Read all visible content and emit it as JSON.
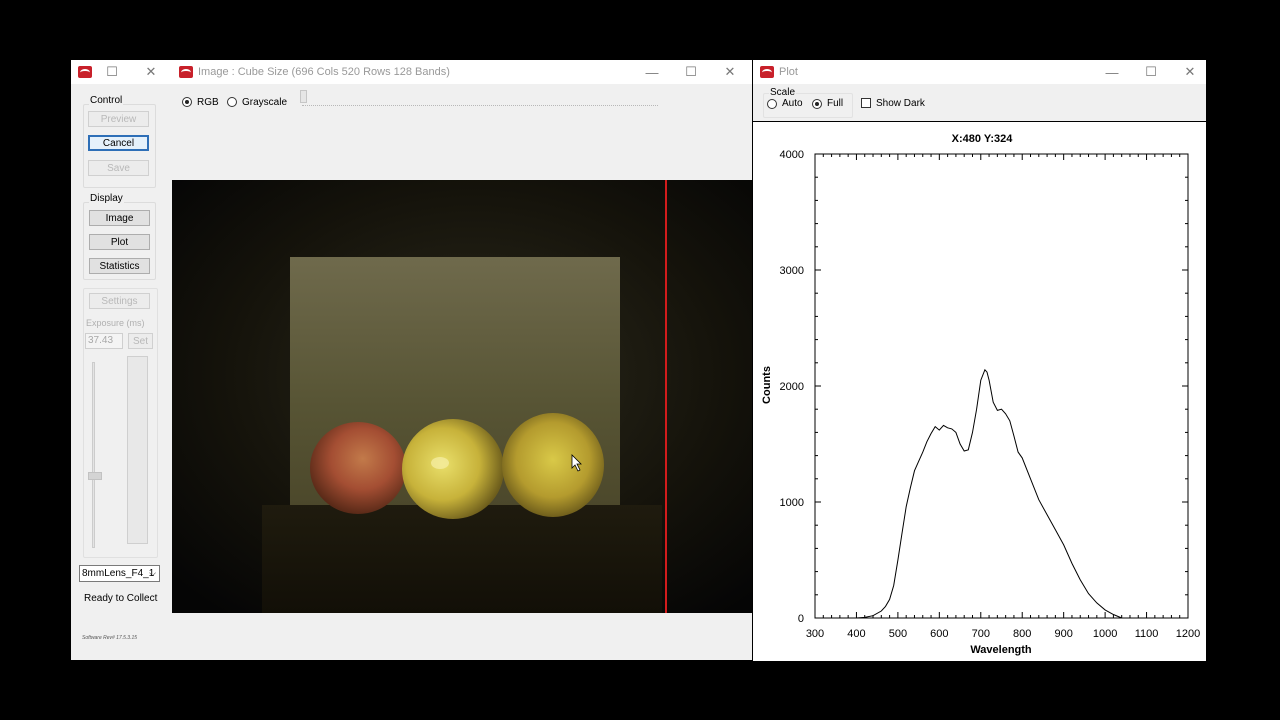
{
  "control_window": {
    "control_group": {
      "label": "Control",
      "preview": "Preview",
      "cancel": "Cancel",
      "save": "Save"
    },
    "display_group": {
      "label": "Display",
      "image": "Image",
      "plot": "Plot",
      "statistics": "Statistics"
    },
    "settings_button": "Settings",
    "exposure": {
      "label": "Exposure (ms)",
      "value": "37.43",
      "set_button": "Set"
    },
    "lens_select": "8mmLens_F4_1",
    "status": "Ready to Collect",
    "software_rev": "Software Rev# 17.5.3.15"
  },
  "image_window": {
    "title": "Image : Cube Size (696 Cols 520 Rows 128 Bands)",
    "rgb_label": "RGB",
    "grayscale_label": "Grayscale",
    "mode_selected": "RGB"
  },
  "plot_window": {
    "title": "Plot",
    "scale_label": "Scale",
    "auto_label": "Auto",
    "full_label": "Full",
    "show_dark_label": "Show Dark",
    "scale_selected": "Full"
  },
  "chart_data": {
    "type": "line",
    "title": "X:480 Y:324",
    "xlabel": "Wavelength",
    "ylabel": "Counts",
    "xlim": [
      300,
      1200
    ],
    "ylim": [
      0,
      4000
    ],
    "xticks": [
      300,
      400,
      500,
      600,
      700,
      800,
      900,
      1000,
      1100,
      1200
    ],
    "yticks": [
      0,
      1000,
      2000,
      3000,
      4000
    ],
    "line_color": "#000000",
    "series": [
      {
        "x": [
          400,
          420,
          440,
          460,
          470,
          480,
          490,
          500,
          510,
          520,
          530,
          540,
          550,
          560,
          570,
          580,
          590,
          600,
          610,
          620,
          630,
          640,
          650,
          660,
          670,
          680,
          690,
          700,
          710,
          715,
          720,
          730,
          740,
          750,
          760,
          770,
          780,
          790,
          800,
          820,
          840,
          860,
          880,
          900,
          920,
          940,
          960,
          980,
          1000,
          1020,
          1040
        ],
        "y": [
          0,
          5,
          20,
          60,
          100,
          160,
          280,
          500,
          730,
          960,
          1120,
          1270,
          1350,
          1430,
          1520,
          1590,
          1650,
          1620,
          1660,
          1640,
          1630,
          1600,
          1500,
          1440,
          1450,
          1600,
          1800,
          2050,
          2140,
          2120,
          2050,
          1860,
          1790,
          1800,
          1760,
          1700,
          1570,
          1430,
          1380,
          1200,
          1020,
          890,
          760,
          630,
          470,
          330,
          210,
          130,
          70,
          30,
          0
        ]
      }
    ]
  }
}
